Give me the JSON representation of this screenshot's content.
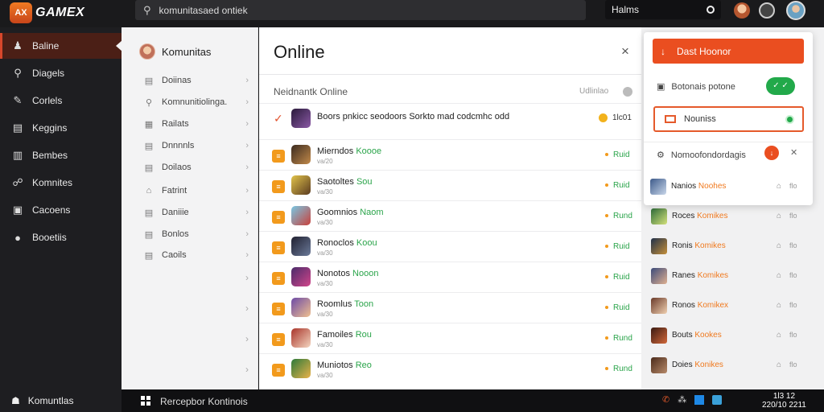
{
  "app": {
    "logo_badge": "AX",
    "logo_text": "GAMEX"
  },
  "topbar": {
    "search_value": "komunitasaed ontiek",
    "mini_field": "Halms"
  },
  "sidebar": {
    "items": [
      {
        "icon": "♟",
        "label": "Baline",
        "active": true
      },
      {
        "icon": "⚲",
        "label": "Diagels"
      },
      {
        "icon": "✎",
        "label": "Corlels"
      },
      {
        "icon": "▤",
        "label": "Keggins"
      },
      {
        "icon": "▥",
        "label": "Bembes"
      },
      {
        "icon": "☍",
        "label": "Komnites"
      },
      {
        "icon": "▣",
        "label": "Cacoens"
      },
      {
        "icon": "●",
        "label": "Booetiis"
      }
    ],
    "bottom": {
      "icon": "☗",
      "label": "Komuntlas"
    }
  },
  "navcol": {
    "title": "Komunitas",
    "items": [
      {
        "icon": "▤",
        "label": "Doiinas"
      },
      {
        "icon": "⚲",
        "label": "Komnunitiolinga."
      },
      {
        "icon": "▦",
        "label": "Railats"
      },
      {
        "icon": "▤",
        "label": "Dnnnnls"
      },
      {
        "icon": "▤",
        "label": "Doilaos"
      },
      {
        "icon": "⌂",
        "label": "Fatrint"
      },
      {
        "icon": "▤",
        "label": "Daniiie"
      },
      {
        "icon": "▤",
        "label": "Bonlos"
      },
      {
        "icon": "▤",
        "label": "Caoils"
      }
    ],
    "extra_chevrons": [
      "›",
      "›",
      "›",
      "›"
    ]
  },
  "main": {
    "title": "Online",
    "close": "×",
    "subtitle": "Neidnantk Online",
    "sub_right": "Udlinlao",
    "first_row": {
      "check": "✓",
      "name": "Boors pnkicc seodoors Sorkto mad codcmhc odd",
      "count": "1lc01"
    },
    "rows": [
      {
        "marker": "≡",
        "name": "Mierndos",
        "tag": "Koooe",
        "sub": "va/20",
        "status": "Ruid",
        "avatar": "linear-gradient(135deg,#3a2a1f,#c28a4a)"
      },
      {
        "marker": "≡",
        "name": "Saotoltes",
        "tag": "Sou",
        "sub": "va/30",
        "status": "Ruid",
        "avatar": "linear-gradient(135deg,#e1c34a,#5b3b20)"
      },
      {
        "marker": "≡",
        "name": "Goomnios",
        "tag": "Naom",
        "sub": "va/30",
        "status": "Rund",
        "avatar": "linear-gradient(135deg,#79c7e3,#c9413b)"
      },
      {
        "marker": "≡",
        "name": "Ronoclos",
        "tag": "Koou",
        "sub": "va/30",
        "status": "Ruid",
        "avatar": "linear-gradient(135deg,#202030,#6b7a99)"
      },
      {
        "marker": "≡",
        "name": "Nonotos",
        "tag": "Nooon",
        "sub": "va/30",
        "status": "Ruid",
        "avatar": "linear-gradient(135deg,#4a2b6a,#d1458a)"
      },
      {
        "marker": "≡",
        "name": "Roomlus",
        "tag": "Toon",
        "sub": "va/30",
        "status": "Ruid",
        "avatar": "linear-gradient(135deg,#6c4aa6,#f0c090)"
      },
      {
        "marker": "≡",
        "name": "Famoiles",
        "tag": "Rou",
        "sub": "va/30",
        "status": "Rund",
        "avatar": "linear-gradient(135deg,#a9342a,#f4d6c0)"
      },
      {
        "marker": "≡",
        "name": "Muniotos",
        "tag": "Reo",
        "sub": "va/30",
        "status": "Rund",
        "avatar": "linear-gradient(135deg,#2d7a3a,#e9b24a)"
      }
    ]
  },
  "popup": {
    "button_label": "Dast Hoonor",
    "button_icon": "↓",
    "line1": "Botonais potone",
    "toggle": "✓ ✓",
    "box_label": "Nouniss",
    "line2": "Nomoofondordagis",
    "orange_dot": "↓",
    "x_icon": "✕",
    "row": {
      "name": "Nanios",
      "tag": "Noohes",
      "count": "flo"
    }
  },
  "right_rows": [
    {
      "name": "Roces",
      "tag": "Komikes",
      "count": "flo",
      "avatar": "linear-gradient(135deg,#2f6d3a,#d3e07a)"
    },
    {
      "name": "Ronis",
      "tag": "Komikes",
      "count": "flo",
      "avatar": "linear-gradient(135deg,#20304a,#c58f3a)"
    },
    {
      "name": "Ranes",
      "tag": "Komikes",
      "count": "flo",
      "avatar": "linear-gradient(135deg,#3b4a7a,#e0b090)"
    },
    {
      "name": "Ronos",
      "tag": "Komikex",
      "count": "flo",
      "avatar": "linear-gradient(135deg,#6a3a2a,#f0d0b0)"
    },
    {
      "name": "Bouts",
      "tag": "Kookes",
      "count": "flo",
      "avatar": "linear-gradient(135deg,#3a1a12,#d2683a)"
    },
    {
      "name": "Doies",
      "tag": "Konikes",
      "count": "flo",
      "avatar": "linear-gradient(135deg,#4a2a1a,#b78a6a)"
    }
  ],
  "taskbar": {
    "title": "Rercepbor Kontinois",
    "tray": [
      "✆",
      "⁂"
    ],
    "clock_line1": "1l3 12",
    "clock_line2": "220/10 2211"
  }
}
